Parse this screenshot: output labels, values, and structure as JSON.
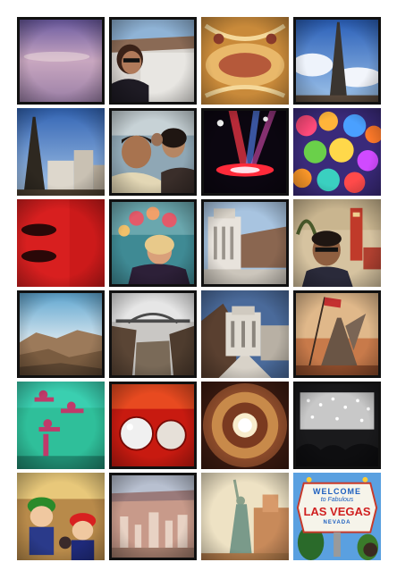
{
  "collage": {
    "background": "#ffffff",
    "tiles": [
      {
        "row": 1,
        "col": 1,
        "subject": "hazy-desert-sky"
      },
      {
        "row": 1,
        "col": 2,
        "subject": "woman-at-hoover-dam"
      },
      {
        "row": 1,
        "col": 3,
        "subject": "ornate-ceiling"
      },
      {
        "row": 1,
        "col": 4,
        "subject": "eiffel-tower-replica-clouds"
      },
      {
        "row": 2,
        "col": 1,
        "subject": "eiffel-tower-and-hotels"
      },
      {
        "row": 2,
        "col": 2,
        "subject": "group-selfie"
      },
      {
        "row": 2,
        "col": 3,
        "subject": "concert-stage-lights"
      },
      {
        "row": 2,
        "col": 4,
        "subject": "glass-flower-ceiling"
      },
      {
        "row": 3,
        "col": 1,
        "subject": "red-lips"
      },
      {
        "row": 3,
        "col": 2,
        "subject": "woman-with-balloons"
      },
      {
        "row": 3,
        "col": 3,
        "subject": "dam-intake-tower"
      },
      {
        "row": 3,
        "col": 4,
        "subject": "man-selfie-with-sign"
      },
      {
        "row": 4,
        "col": 1,
        "subject": "desert-canyon"
      },
      {
        "row": 4,
        "col": 2,
        "subject": "bridge-over-canyon"
      },
      {
        "row": 4,
        "col": 3,
        "subject": "dam-building-walkway"
      },
      {
        "row": 4,
        "col": 4,
        "subject": "winged-statue-flag"
      },
      {
        "row": 5,
        "col": 1,
        "subject": "acrobat-sculptures"
      },
      {
        "row": 5,
        "col": 2,
        "subject": "red-spheres-reflection"
      },
      {
        "row": 5,
        "col": 3,
        "subject": "dome-ceiling"
      },
      {
        "row": 5,
        "col": 4,
        "subject": "lights-ceiling-crowd"
      },
      {
        "row": 6,
        "col": 1,
        "subject": "mario-and-luigi-figures"
      },
      {
        "row": 6,
        "col": 2,
        "subject": "city-aerial-view"
      },
      {
        "row": 6,
        "col": 3,
        "subject": "statue-of-liberty-replica"
      },
      {
        "row": 6,
        "col": 4,
        "subject": "welcome-to-las-vegas-sign"
      }
    ],
    "sign": {
      "welcome": "WELCOME",
      "to": "to Fabulous",
      "city": "LAS VEGAS",
      "state": "NEVADA"
    }
  }
}
